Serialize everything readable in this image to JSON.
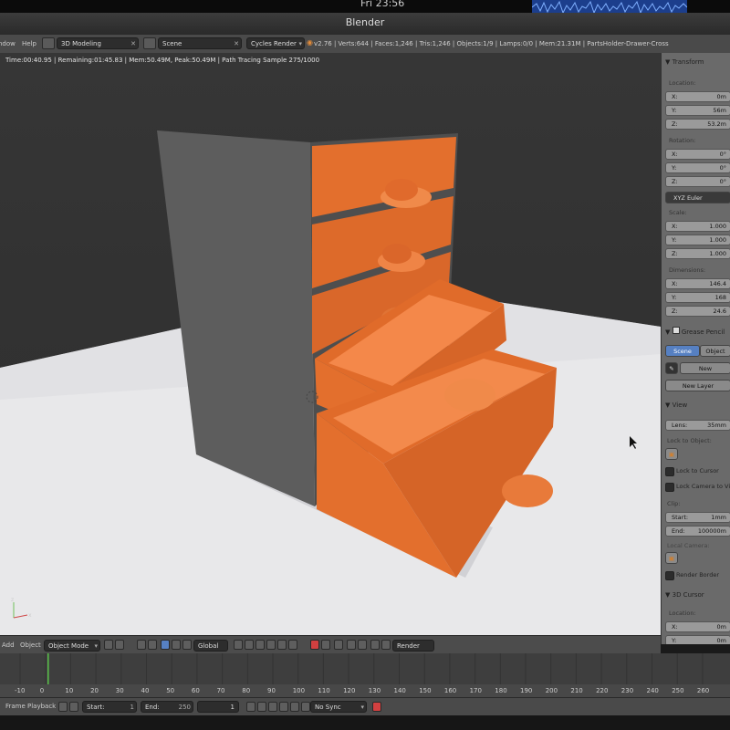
{
  "system": {
    "clock": "Fri 23:56",
    "wave_color": "#1c3e8c"
  },
  "window": {
    "title": "Blender"
  },
  "info_header": {
    "menu": [
      "ndow",
      "Help"
    ],
    "screen_layout": "3D Modeling",
    "scene": "Scene",
    "render_engine": "Cycles Render",
    "stats": "v2.76 | Verts:644 | Faces:1,246 | Tris:1,246 | Objects:1/9 | Lamps:0/0 | Mem:21.31M | PartsHolder-Drawer-Cross"
  },
  "render_info": "Time:00:40.95 | Remaining:01:45.83 | Mem:50.49M, Peak:50.49M | Path Tracing Sample 275/1000",
  "viewport": {
    "model_color": "#e26f2f",
    "cabinet_color": "#5a5a5a"
  },
  "properties": {
    "transform_header": "Transform",
    "location_label": "Location:",
    "location": [
      {
        "k": "X:",
        "v": "0m"
      },
      {
        "k": "Y:",
        "v": "56m"
      },
      {
        "k": "Z:",
        "v": "53.2m"
      }
    ],
    "rotation_label": "Rotation:",
    "rotation": [
      {
        "k": "X:",
        "v": "0°"
      },
      {
        "k": "Y:",
        "v": "0°"
      },
      {
        "k": "Z:",
        "v": "0°"
      }
    ],
    "rotation_mode": "XYZ Euler",
    "scale_label": "Scale:",
    "scale": [
      {
        "k": "X:",
        "v": "1.000"
      },
      {
        "k": "Y:",
        "v": "1.000"
      },
      {
        "k": "Z:",
        "v": "1.000"
      }
    ],
    "dimensions_label": "Dimensions:",
    "dimensions": [
      {
        "k": "X:",
        "v": "146.4"
      },
      {
        "k": "Y:",
        "v": "168"
      },
      {
        "k": "Z:",
        "v": "24.6"
      }
    ],
    "grease_header": "Grease Pencil",
    "grease_tabs": [
      "Scene",
      "Object"
    ],
    "new_btn": "New",
    "new_layer_btn": "New Layer",
    "view_header": "View",
    "lens": {
      "k": "Lens:",
      "v": "35mm"
    },
    "lock_to_object": "Lock to Object:",
    "lock_to_cursor": "Lock to Cursor",
    "lock_camera_to_view": "Lock Camera to View",
    "clip_label": "Clip:",
    "clip": [
      {
        "k": "Start:",
        "v": "1mm"
      },
      {
        "k": "End:",
        "v": "100000m"
      }
    ],
    "local_camera": "Local Camera:",
    "render_border": "Render Border",
    "cursor_header": "3D Cursor",
    "cursor_location_label": "Location:",
    "cursor": [
      {
        "k": "X:",
        "v": "0m"
      },
      {
        "k": "Y:",
        "v": "0m"
      }
    ]
  },
  "header3d": {
    "menu": [
      "Add",
      "Object"
    ],
    "mode": "Object Mode",
    "orientation": "Global",
    "render_layer": "Render Layer"
  },
  "timeline": {
    "frame_numbers": [
      "-10",
      "0",
      "10",
      "20",
      "30",
      "40",
      "50",
      "60",
      "70",
      "80",
      "90",
      "100",
      "110",
      "120",
      "130",
      "140",
      "150",
      "160",
      "170",
      "180",
      "190",
      "200",
      "210",
      "220",
      "230",
      "240",
      "250",
      "260"
    ],
    "footer_menu": [
      "Frame",
      "Playback"
    ],
    "start": "Start:",
    "start_value": "1",
    "end": "End:",
    "end_value": "250",
    "current_frame": "1",
    "sync": "No Sync"
  }
}
